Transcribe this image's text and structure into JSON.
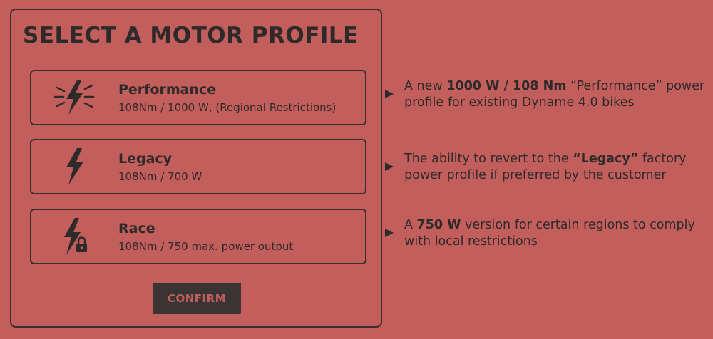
{
  "panel": {
    "title": "SELECT A MOTOR PROFILE",
    "profiles": [
      {
        "name": "Performance",
        "desc": "108Nm / 1000 W, (Regional Restrictions)",
        "icon": "lightning-burst-icon"
      },
      {
        "name": "Legacy",
        "desc": "108Nm / 700 W",
        "icon": "lightning-icon"
      },
      {
        "name": "Race",
        "desc": "108Nm / 750 max. power output",
        "icon": "lightning-lock-icon"
      }
    ],
    "confirm_label": "CONFIRM"
  },
  "notes": [
    {
      "icon": "arrow-right-icon",
      "pre": "A new ",
      "bold": "1000 W / 108 Nm",
      "post": " “Performance” power profile for existing Dyname 4.0 bikes"
    },
    {
      "icon": "arrow-right-icon",
      "pre": "The ability to revert to the ",
      "bold": "“Legacy”",
      "post": " factory power profile if preferred by the customer"
    },
    {
      "icon": "arrow-right-icon",
      "pre": "A ",
      "bold": "750 W",
      "post": " version for certain regions to comply with local restrictions"
    }
  ],
  "colors": {
    "background": "#c25e5c",
    "dark": "#2f2a2a",
    "button_bg": "#3a3434"
  }
}
